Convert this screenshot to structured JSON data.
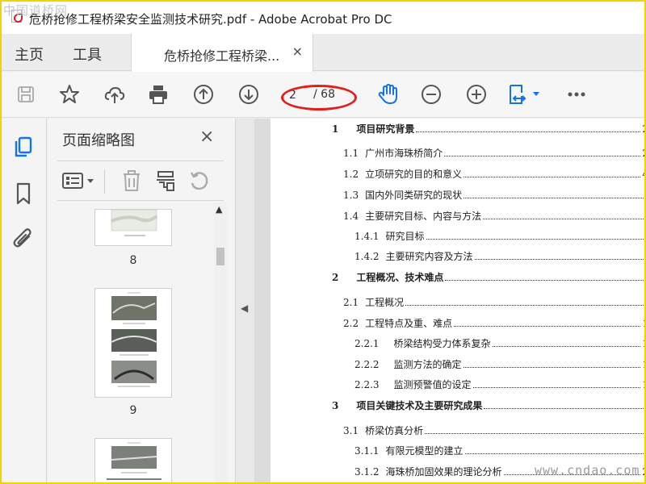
{
  "watermark_top": "中国道桥网",
  "watermark_bottom": "www.cndao.com",
  "window": {
    "title": "危桥抢修工程桥梁安全监测技术研究.pdf - Adobe Acrobat Pro DC"
  },
  "tabs": {
    "home": "主页",
    "tools": "工具",
    "document": "危桥抢修工程桥梁...",
    "close": "×"
  },
  "toolbar": {
    "save_icon": "save-icon",
    "bookmark_icon": "star-icon",
    "upload_icon": "cloud-upload-icon",
    "print_icon": "print-icon",
    "prev_icon": "arrow-up-circle-icon",
    "next_icon": "arrow-down-circle-icon",
    "page_current": "2",
    "page_total": "/ 68",
    "hand_icon": "hand-icon",
    "zoom_out_icon": "zoom-out-icon",
    "zoom_in_icon": "zoom-in-icon",
    "fit_icon": "fit-width-icon",
    "more_icon": "more-icon",
    "accent_color": "#1473e6",
    "highlight_color": "#e0201a"
  },
  "left_rail": {
    "icons": [
      "page-thumbnails-icon",
      "bookmark-icon",
      "attachment-icon"
    ]
  },
  "thumb_panel": {
    "title": "页面缩略图",
    "close": "×",
    "pages": [
      {
        "label": "8"
      },
      {
        "label": "9"
      }
    ]
  },
  "toc": [
    {
      "num": "1",
      "title": "项目研究背景",
      "page": "2",
      "bold": true
    },
    {
      "num": "1.1",
      "title": "广州市海珠桥简介",
      "page": "2",
      "bold": false
    },
    {
      "num": "1.2",
      "title": "立项研究的目的和意义",
      "page": "4",
      "bold": false
    },
    {
      "num": "1.3",
      "title": "国内外同类研究的现状",
      "page": "",
      "bold": false
    },
    {
      "num": "1.4",
      "title": "主要研究目标、内容与方法",
      "page": "",
      "bold": false
    },
    {
      "num": "1.4.1",
      "title": "研究目标",
      "page": "",
      "bold": false
    },
    {
      "num": "1.4.2",
      "title": "主要研究内容及方法",
      "page": "",
      "bold": false
    },
    {
      "num": "2",
      "title": "工程概况、技术难点",
      "page": "",
      "bold": true
    },
    {
      "num": "2.1",
      "title": "工程概况",
      "page": "",
      "bold": false
    },
    {
      "num": "2.2",
      "title": "工程特点及重、难点",
      "page": "1",
      "bold": false
    },
    {
      "num": "2.2.1",
      "title": "桥梁结构受力体系复杂",
      "page": "1",
      "bold": false
    },
    {
      "num": "2.2.2",
      "title": "监测方法的确定",
      "page": "1",
      "bold": false
    },
    {
      "num": "2.2.3",
      "title": "监测预警值的设定",
      "page": "1",
      "bold": false
    },
    {
      "num": "3",
      "title": "项目关键技术及主要研究成果",
      "page": "",
      "bold": true
    },
    {
      "num": "3.1",
      "title": "桥梁仿真分析",
      "page": "",
      "bold": false
    },
    {
      "num": "3.1.1",
      "title": "有限元模型的建立",
      "page": "",
      "bold": false
    },
    {
      "num": "3.1.2",
      "title": "海珠桥加固效果的理论分析",
      "page": "2",
      "bold": false
    }
  ]
}
